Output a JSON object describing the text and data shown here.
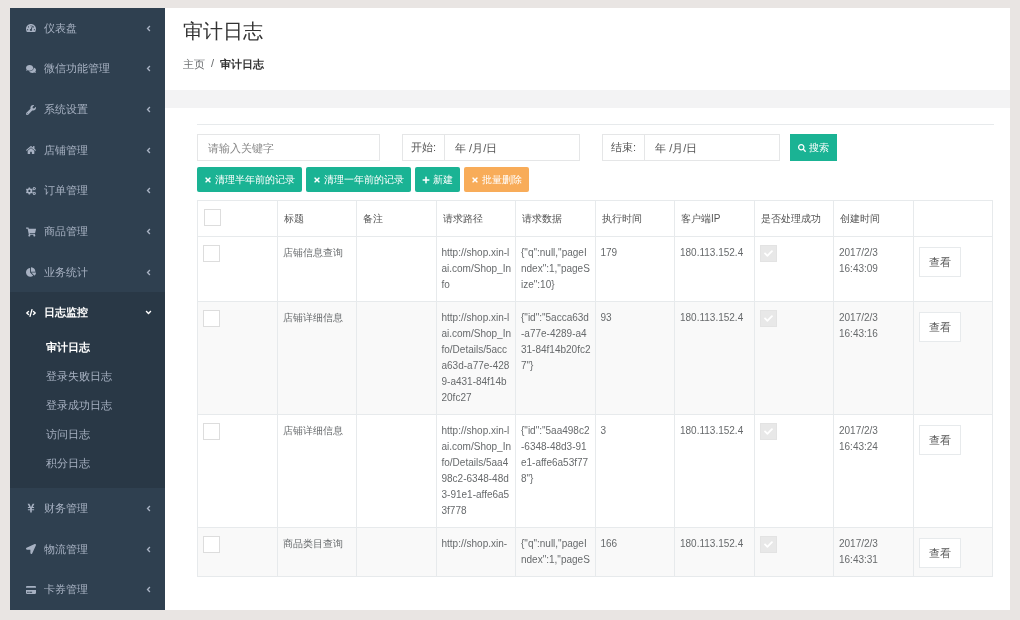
{
  "sidebar": {
    "items": [
      {
        "label": "仪表盘",
        "expanded": false
      },
      {
        "label": "微信功能管理",
        "expanded": false
      },
      {
        "label": "系统设置",
        "expanded": false
      },
      {
        "label": "店铺管理",
        "expanded": false
      },
      {
        "label": "订单管理",
        "expanded": false
      },
      {
        "label": "商品管理",
        "expanded": false
      },
      {
        "label": "业务统计",
        "expanded": false
      },
      {
        "label": "日志监控",
        "expanded": true,
        "children": [
          {
            "label": "审计日志",
            "selected": true
          },
          {
            "label": "登录失败日志",
            "selected": false
          },
          {
            "label": "登录成功日志",
            "selected": false
          },
          {
            "label": "访问日志",
            "selected": false
          },
          {
            "label": "积分日志",
            "selected": false
          }
        ]
      },
      {
        "label": "财务管理",
        "expanded": false
      },
      {
        "label": "物流管理",
        "expanded": false
      },
      {
        "label": "卡券管理",
        "expanded": false
      }
    ]
  },
  "header": {
    "title": "审计日志",
    "breadcrumb": [
      "主页",
      "审计日志"
    ],
    "separator": "/"
  },
  "filters": {
    "keyword": {
      "placeholder": "请输入关键字"
    },
    "start": {
      "label": "开始:",
      "placeholder": "年 /月/日"
    },
    "end": {
      "label": "结束:",
      "placeholder": "年 /月/日"
    },
    "search": "搜索"
  },
  "actions": [
    {
      "label": "清理半年前的记录",
      "kind": "clear"
    },
    {
      "label": "清理一年前的记录",
      "kind": "clear"
    },
    {
      "label": "新建",
      "kind": "add"
    },
    {
      "label": "批量删除",
      "kind": "delete"
    }
  ],
  "table": {
    "columns": [
      "标题",
      "备注",
      "请求路径",
      "请求数据",
      "执行时间",
      "客户端IP",
      "是否处理成功",
      "创建时间"
    ],
    "header_checked": false,
    "rows": [
      {
        "checked": false,
        "title": "店铺信息查询",
        "path": "http://shop.xin-lai.com/Shop_Info",
        "data": "{\"q\":null,\"pageIndex\":1,\"pageSize\":10}",
        "time": "179",
        "ip": "180.113.152.4",
        "success": true,
        "created": "2017/2/3 16:43:09",
        "action": "查看"
      },
      {
        "checked": false,
        "title": "店铺详细信息",
        "path": "http://shop.xin-lai.com/Shop_Info/Details/5acca63d-a77e-4289-a431-84f14b20fc27",
        "data": "{\"id\":\"5acca63d-a77e-4289-a431-84f14b20fc27\"}",
        "time": "93",
        "ip": "180.113.152.4",
        "success": true,
        "created": "2017/2/3 16:43:16",
        "action": "查看"
      },
      {
        "checked": false,
        "title": "店铺详细信息",
        "path": "http://shop.xin-lai.com/Shop_Info/Details/5aa498c2-6348-48d3-91e1-affe6a53f778",
        "data": "{\"id\":\"5aa498c2-6348-48d3-91e1-affe6a53f778\"}",
        "time": "3",
        "ip": "180.113.152.4",
        "success": true,
        "created": "2017/2/3 16:43:24",
        "action": "查看"
      },
      {
        "checked": false,
        "title": "商品类目查询",
        "path": "http://shop.xin-",
        "data": "{\"q\":null,\"pageIndex\":1,\"pageS",
        "time": "166",
        "ip": "180.113.152.4",
        "success": true,
        "created": "2017/2/3 16:43:31",
        "action": "查看"
      }
    ]
  }
}
